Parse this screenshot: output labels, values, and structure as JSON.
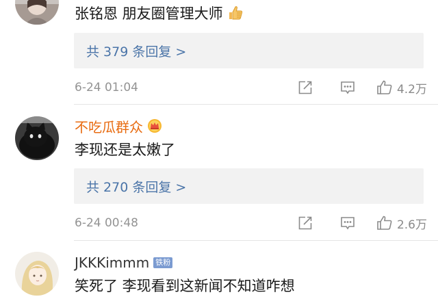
{
  "comments": [
    {
      "username": "",
      "text": "张铭恩 朋友圈管理大师",
      "text_icon": "thumbs-up-emoji-icon",
      "replies_label": "共 379 条回复 >",
      "timestamp": "6-24 01:04",
      "likes": "4.2万"
    },
    {
      "username": "不吃瓜群众",
      "username_color": "#e86b10",
      "username_icon": "crown-badge-icon",
      "text": "李现还是太嫩了",
      "replies_label": "共 270 条回复 >",
      "timestamp": "6-24 00:48",
      "likes": "2.6万"
    },
    {
      "username": "JKKKimmm",
      "badge": "铁粉",
      "text": "笑死了 李现看到这新闻不知道咋想"
    }
  ],
  "icons": {
    "share": "share-icon",
    "comment": "comment-icon",
    "like": "thumbs-up-icon"
  }
}
